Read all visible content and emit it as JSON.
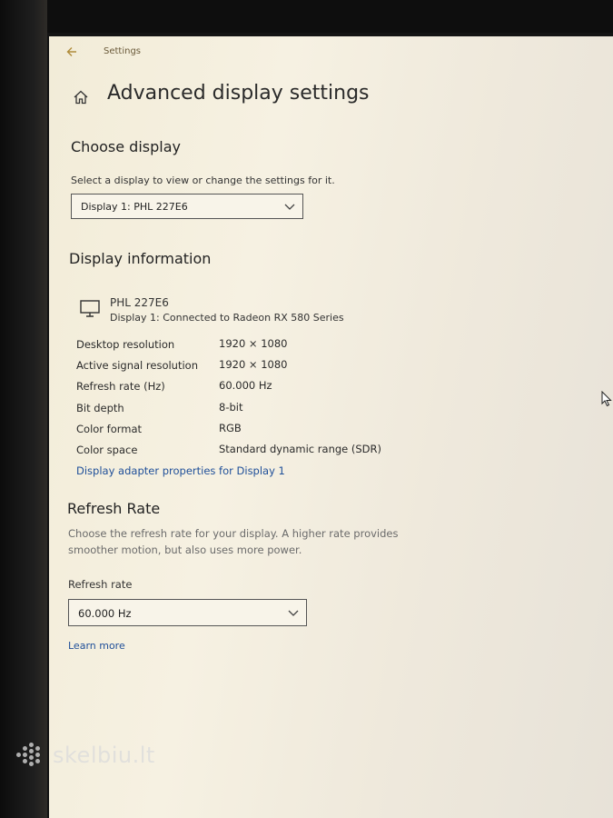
{
  "window": {
    "title": "Settings"
  },
  "header": {
    "title": "Advanced display settings"
  },
  "choose_display": {
    "heading": "Choose display",
    "description": "Select a display to view or change the settings for it.",
    "selected": "Display 1: PHL 227E6"
  },
  "display_info": {
    "heading": "Display information",
    "monitor_name": "PHL 227E6",
    "connection": "Display 1: Connected to Radeon RX 580 Series",
    "rows": [
      {
        "label": "Desktop resolution",
        "value": "1920 × 1080"
      },
      {
        "label": "Active signal resolution",
        "value": "1920 × 1080"
      },
      {
        "label": "Refresh rate (Hz)",
        "value": "60.000 Hz"
      },
      {
        "label": "Bit depth",
        "value": "8-bit"
      },
      {
        "label": "Color format",
        "value": "RGB"
      },
      {
        "label": "Color space",
        "value": "Standard dynamic range (SDR)"
      }
    ],
    "adapter_link": "Display adapter properties for Display 1"
  },
  "refresh_rate": {
    "heading": "Refresh Rate",
    "description_line1": "Choose the refresh rate for your display. A higher rate provides",
    "description_line2": "smoother motion, but also uses more power.",
    "field_label": "Refresh rate",
    "selected": "60.000 Hz",
    "learn_more": "Learn more"
  },
  "watermark": {
    "text": "skelbiu.lt"
  },
  "icons": {
    "back": "back-arrow-icon",
    "home": "home-icon",
    "monitor": "monitor-icon",
    "chevron": "chevron-down-icon",
    "cursor": "mouse-cursor-icon"
  },
  "colors": {
    "link": "#1f4f99",
    "accent": "#b08c3a"
  }
}
